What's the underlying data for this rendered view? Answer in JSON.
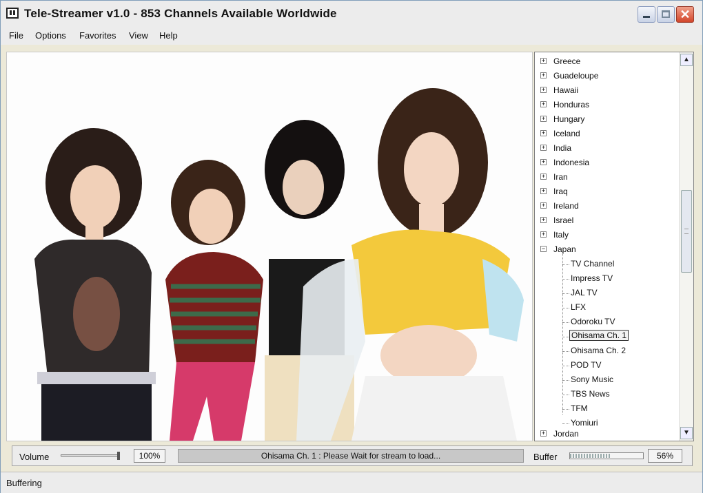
{
  "window": {
    "title": "Tele-Streamer v1.0 - 853 Channels Available Worldwide",
    "close_glyph": "✕"
  },
  "menu": [
    "File",
    "Options",
    "Favorites",
    "View",
    "Help"
  ],
  "tree": {
    "countries": [
      "Greece",
      "Guadeloupe",
      "Hawaii",
      "Honduras",
      "Hungary",
      "Iceland",
      "India",
      "Indonesia",
      "Iran",
      "Iraq",
      "Ireland",
      "Israel",
      "Italy"
    ],
    "expanded_country": "Japan",
    "japan_channels": [
      "TV Channel",
      "Impress TV",
      "JAL TV",
      "LFX",
      "Odoroku TV",
      "Ohisama Ch. 1",
      "Ohisama Ch. 2",
      "POD TV",
      "Sony Music",
      "TBS News",
      "TFM",
      "Yomiuri"
    ],
    "after_country": "Jordan",
    "selected_channel": "Ohisama Ch. 1",
    "collapsed_glyph": "+",
    "expanded_glyph": "−"
  },
  "scrollbar": {
    "up_glyph": "▲",
    "down_glyph": "▼"
  },
  "controls": {
    "volume_label": "Volume",
    "volume_value": "100%",
    "status_message": "Ohisama Ch. 1 : Please Wait for stream to load...",
    "buffer_label": "Buffer",
    "buffer_value": "56%",
    "volume_level": 1.0,
    "buffer_level": 0.56
  },
  "statusbar": {
    "text": "Buffering"
  },
  "video_palette": {
    "background": "#fdfdfd",
    "skin": "#f1d0b8",
    "hair": "#2a1d18",
    "top_yellow": "#f3c93c",
    "top_stripes": "#7a1f1c",
    "pants_pink": "#d63a6a",
    "skirt_white": "#f2f2f2"
  }
}
